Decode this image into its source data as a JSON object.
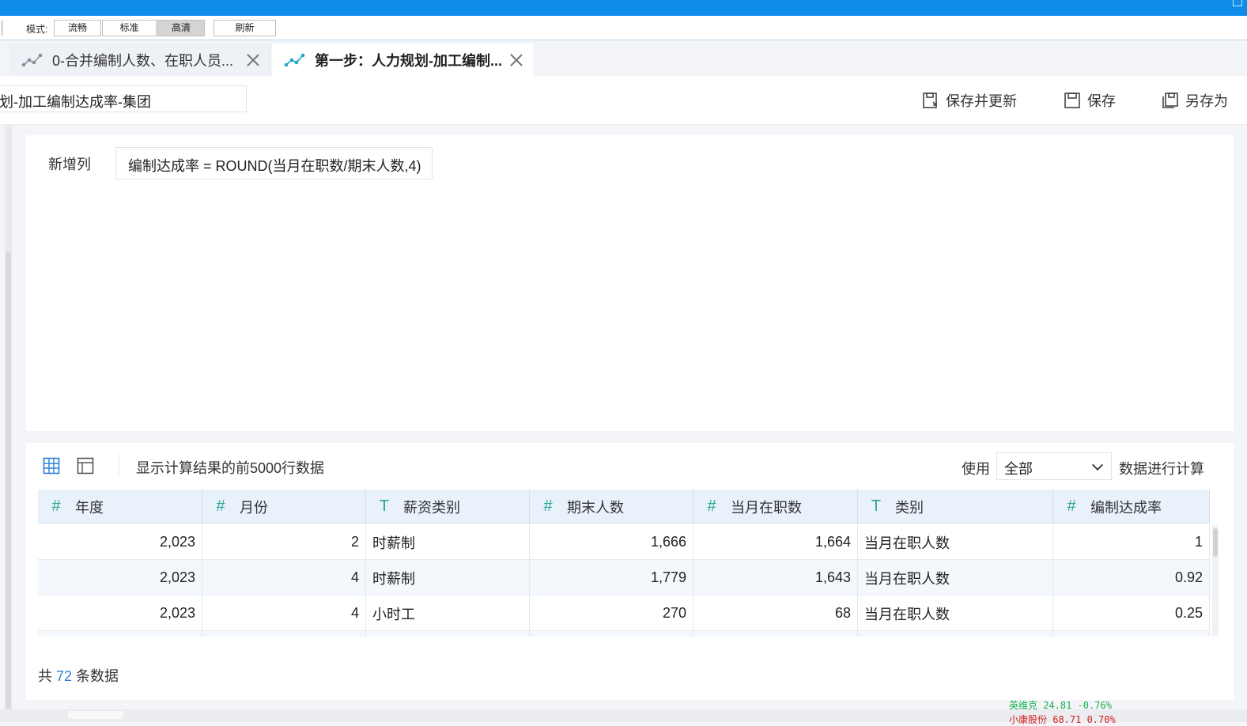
{
  "mode_bar": {
    "label": "模式:",
    "buttons": [
      {
        "label": "流畅",
        "active": false
      },
      {
        "label": "标准",
        "active": false
      },
      {
        "label": "高清",
        "active": true
      }
    ],
    "refresh_label": "刷新"
  },
  "tabs": [
    {
      "label": "0-合并编制人数、在职人员...",
      "active": false,
      "icon": "analysis-flow-icon"
    },
    {
      "label": "第一步：人力规划-加工编制...",
      "active": true,
      "icon": "analysis-flow-icon"
    }
  ],
  "header": {
    "name_value": "划-加工编制达成率-集团",
    "save_update_label": "保存并更新",
    "save_label": "保存",
    "save_as_label": "另存为"
  },
  "formula": {
    "label": "新增列",
    "expression": "编制达成率 = ROUND(当月在职数/期末人数,4)"
  },
  "data_panel": {
    "description": "显示计算结果的前5000行数据",
    "use_label": "使用",
    "use_value": "全部",
    "calc_label": "数据进行计算",
    "columns": [
      {
        "type_icon": "#",
        "name": "年度"
      },
      {
        "type_icon": "#",
        "name": "月份"
      },
      {
        "type_icon": "T",
        "name": "薪资类别"
      },
      {
        "type_icon": "#",
        "name": "期末人数"
      },
      {
        "type_icon": "#",
        "name": "当月在职数"
      },
      {
        "type_icon": "T",
        "name": "类别"
      },
      {
        "type_icon": "#",
        "name": "编制达成率"
      }
    ],
    "rows": [
      [
        "2,023",
        "2",
        "时薪制",
        "1,666",
        "1,664",
        "当月在职人数",
        "1"
      ],
      [
        "2,023",
        "4",
        "时薪制",
        "1,779",
        "1,643",
        "当月在职人数",
        "0.92"
      ],
      [
        "2,023",
        "4",
        "小时工",
        "270",
        "68",
        "当月在职人数",
        "0.25"
      ]
    ],
    "footer_prefix": "共",
    "footer_count": "72",
    "footer_suffix": "条数据"
  },
  "ticker": {
    "line1": "英维克   24.81 -0.76%",
    "line2": "小康股份 68.71 0.70%"
  },
  "colors": {
    "topbar": "#0e8ce8",
    "type_icon": "#2aa39a",
    "count_link": "#2c7fd4",
    "header_bg": "#e9f1fb"
  }
}
